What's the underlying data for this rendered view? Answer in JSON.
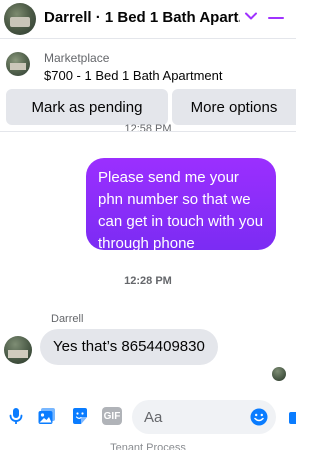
{
  "header": {
    "title": "Darrell · 1 Bed 1 Bath Apart...",
    "accent_color": "#a033ff",
    "icons": [
      "chevron-down-icon",
      "minimize-icon"
    ]
  },
  "marketplace": {
    "source": "Marketplace",
    "listing": "$700 - 1 Bed 1 Bath Apartment"
  },
  "actions": {
    "mark_pending": "Mark as pending",
    "more_options": "More options"
  },
  "clipped_timestamp": "12:58 PM",
  "messages": [
    {
      "direction": "outgoing",
      "text": "Please send me your phn number so that we can get in touch with you through phone"
    },
    {
      "timestamp": "12:28 PM"
    },
    {
      "direction": "incoming",
      "sender": "Darrell",
      "text": "Yes that’s 8654409830"
    }
  ],
  "composer": {
    "placeholder": "Aa",
    "gif_label": "GIF",
    "icons": [
      "microphone-icon",
      "photo-icon",
      "sticker-icon",
      "gif-icon",
      "emoji-icon",
      "like-icon"
    ],
    "icon_color": "#0a7cff"
  },
  "bottom_clipped_text": "Tenant Process"
}
